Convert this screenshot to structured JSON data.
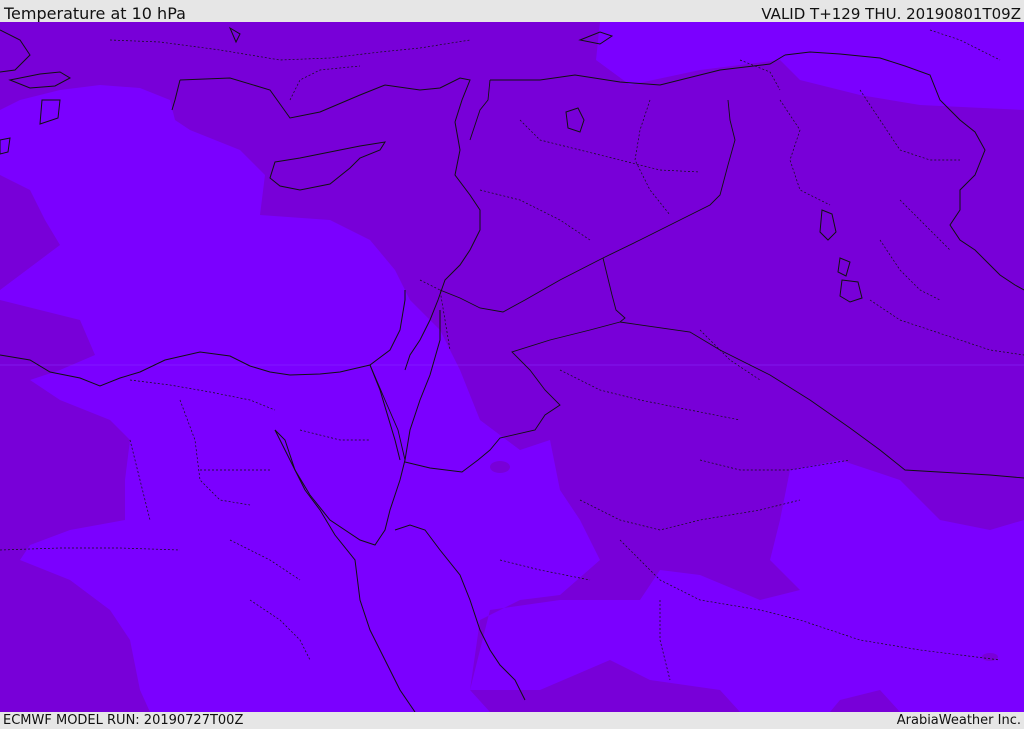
{
  "header": {
    "title": "Temperature at 10 hPa",
    "valid_time": "VALID T+129 THU. 20190801T09Z"
  },
  "footer": {
    "model_run": "ECMWF MODEL RUN: 20190727T00Z",
    "credit": "ArabiaWeather Inc."
  },
  "map": {
    "field": "temperature",
    "level": "10 hPa",
    "fill_colors": {
      "lighter_band": "#7b00ff",
      "darker_band": "#7800d8"
    },
    "line_colors": {
      "coastlines_and_borders": "#111111"
    }
  }
}
